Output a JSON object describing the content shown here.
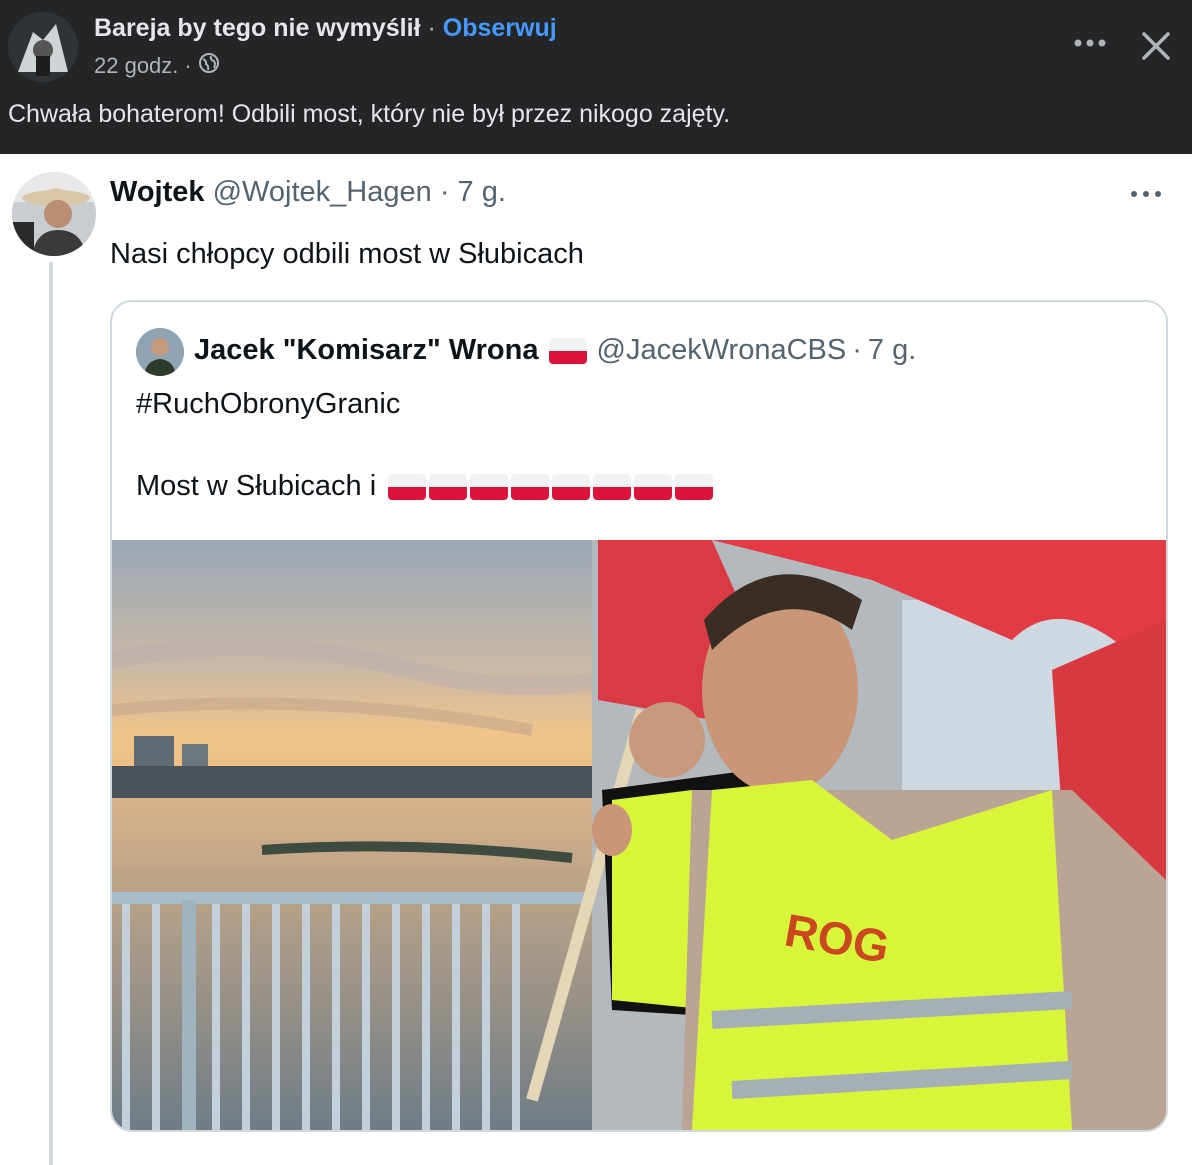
{
  "facebook": {
    "page_name": "Bareja by tego nie wymyślił",
    "separator": "·",
    "follow_label": "Obserwuj",
    "time": "22 godz.",
    "meta_separator": "·",
    "audience_icon": "globe-icon",
    "post_text": "Chwała bohaterom! Odbili most, który nie był przez nikogo zajęty.",
    "more_icon": "more-icon",
    "close_icon": "close-icon"
  },
  "tweet": {
    "name": "Wojtek",
    "handle": "@Wojtek_Hagen",
    "time_sep": "·",
    "time": "7 g.",
    "text": "Nasi chłopcy odbili most w Słubicach",
    "more_icon": "more-icon"
  },
  "quoted_tweet": {
    "name": "Jacek \"Komisarz\" Wrona",
    "name_flag": "flag-poland-icon",
    "handle": "@JacekWronaCBS",
    "time_sep": "·",
    "time": "7 g.",
    "hashtag": "#RuchObronyGranic",
    "text": "Most w Słubicach i",
    "trailing_flags": [
      "flag-poland-icon",
      "flag-poland-icon",
      "flag-poland-icon",
      "flag-poland-icon",
      "flag-poland-icon",
      "flag-poland-icon",
      "flag-poland-icon",
      "flag-poland-icon"
    ],
    "vest_logo": "ROG"
  },
  "colors": {
    "fb_background": "#242526",
    "fb_link": "#4599ff",
    "tweet_text": "#0f1419",
    "tweet_secondary": "#536471",
    "polish_red": "#dc143c",
    "vest_yellow": "#d9f53a"
  }
}
